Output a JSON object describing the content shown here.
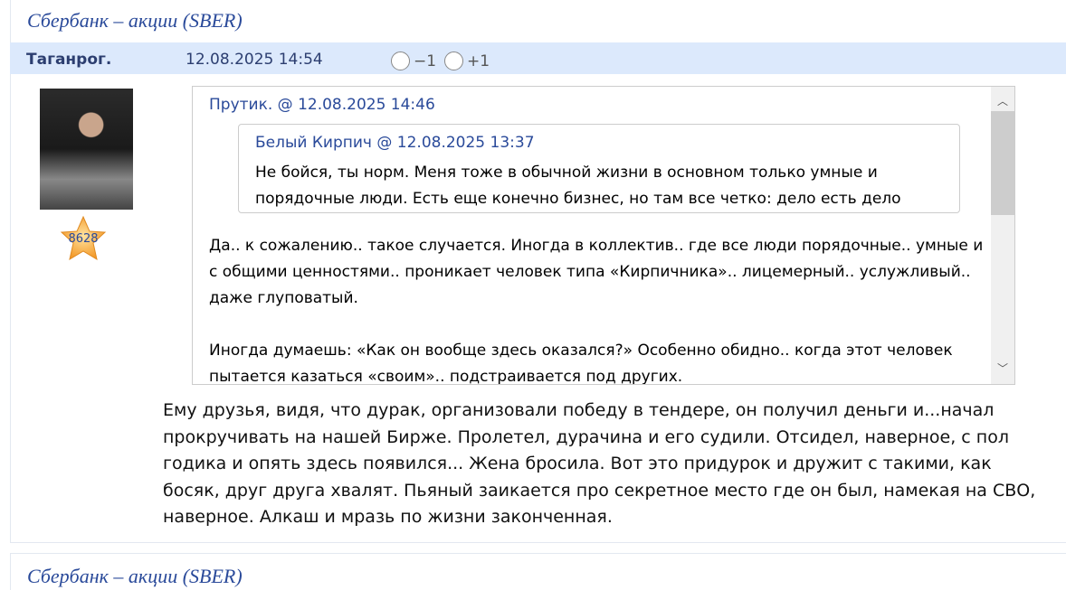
{
  "post": {
    "title": "Сбербанк – акции (SBER)",
    "author": "Таганрог.",
    "date": "12.08.2025 14:54",
    "vote_minus": "−1",
    "vote_plus": "+1",
    "rating": "8628",
    "quote": {
      "header": "Прутик. @ 12.08.2025 14:46",
      "inner": {
        "header": "Белый Кирпич @ 12.08.2025 13:37",
        "text": "Не бойся, ты норм. Меня тоже в обычной жизни в основном только умные и порядочные люди. Есть еще конечно бизнес, но там все четко: дело есть дело"
      },
      "paragraphs": [
        "Да.. к сожалению.. такое случается. Иногда в коллектив.. где все люди порядочные.. умные и с общими ценностями.. проникает человек типа «Кирпичника».. лицемерный.. услужливый.. даже глуповатый.",
        "Иногда думаешь: «Как он вообще здесь оказался?» Особенно обидно.. когда этот человек пытается казаться «своим».. подстраивается под других."
      ]
    },
    "body": "Ему друзья, видя, что дурак, организовали победу в тендере, он получил деньги и...начал прокручивать на нашей Бирже. Пролетел, дурачина и его судили. Отсидел, наверное, с пол годика и опять здесь появился... Жена бросила. Вот это придурок и дружит с такими, как босяк, друг друга хвалят. Пьяный заикается про секретное место где он был, намекая на СВО, наверное. Алкаш и мразь по жизни законченная."
  },
  "next_post": {
    "title": "Сбербанк – акции (SBER)"
  }
}
